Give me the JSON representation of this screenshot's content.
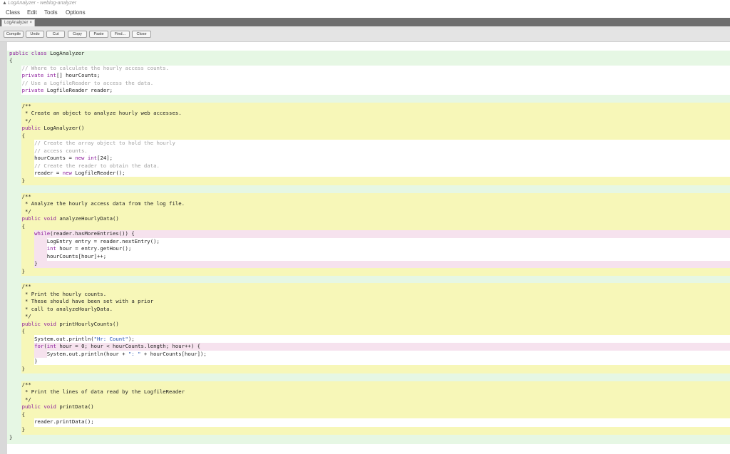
{
  "window": {
    "title": "LogAnalyzer - weblog-analyzer"
  },
  "menu": [
    "Class",
    "Edit",
    "Tools",
    "Options"
  ],
  "tab": {
    "label": "LogAnalyzer",
    "close": "×"
  },
  "toolbar": [
    "Compile",
    "Undo",
    "Cut",
    "Copy",
    "Paste",
    "Find...",
    "Close"
  ],
  "colors": {
    "class_scope": "#e6f7e4",
    "method_scope": "#f7f7b8",
    "body_scope": "#ffffff",
    "loop_scope": "#f6e2ee",
    "keyword": "#8b1a9b",
    "comment": "#a0a0a0",
    "string": "#1f4fb0"
  },
  "code": [
    "public class LogAnalyzer",
    "{",
    "    // Where to calculate the hourly access counts.",
    "    private int[] hourCounts;",
    "    // Use a LogfileReader to access the data.",
    "    private LogfileReader reader;",
    "",
    "    /**",
    "     * Create an object to analyze hourly web accesses.",
    "     */",
    "    public LogAnalyzer()",
    "    {",
    "        // Create the array object to hold the hourly",
    "        // access counts.",
    "        hourCounts = new int[24];",
    "        // Create the reader to obtain the data.",
    "        reader = new LogfileReader();",
    "    }",
    "",
    "    /**",
    "     * Analyze the hourly access data from the log file.",
    "     */",
    "    public void analyzeHourlyData()",
    "    {",
    "        while(reader.hasMoreEntries()) {",
    "            LogEntry entry = reader.nextEntry();",
    "            int hour = entry.getHour();",
    "            hourCounts[hour]++;",
    "        }",
    "    }",
    "",
    "    /**",
    "     * Print the hourly counts.",
    "     * These should have been set with a prior",
    "     * call to analyzeHourlyData.",
    "     */",
    "    public void printHourlyCounts()",
    "    {",
    "        System.out.println(\"Hr: Count\");",
    "        for(int hour = 0; hour < hourCounts.length; hour++) {",
    "            System.out.println(hour + \": \" + hourCounts[hour]);",
    "        }",
    "    }",
    "",
    "    /**",
    "     * Print the lines of data read by the LogfileReader",
    "     */",
    "    public void printData()",
    "    {",
    "        reader.printData();",
    "    }",
    "}"
  ]
}
